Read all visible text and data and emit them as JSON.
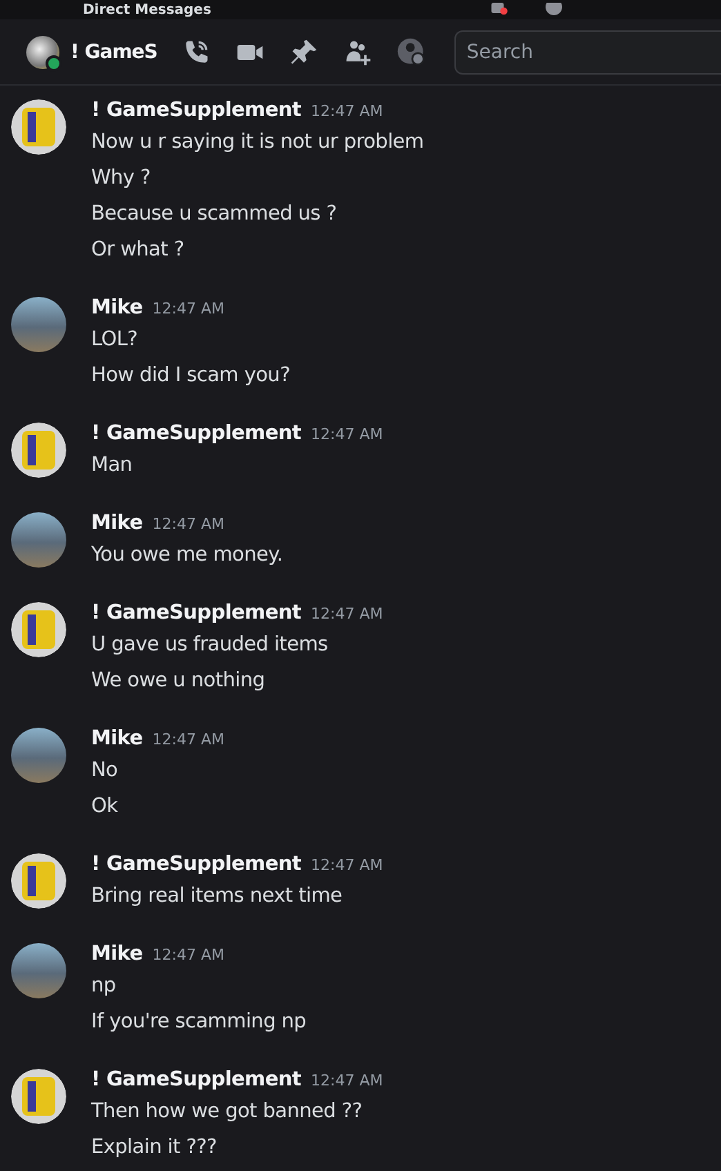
{
  "top_bar": {
    "title": "Direct Messages"
  },
  "header": {
    "name": "! GameS",
    "online": true,
    "search": {
      "placeholder": "Search"
    }
  },
  "messages": [
    {
      "author": "! GameSupplement",
      "kind": "logo",
      "time": "12:47 AM",
      "lines": [
        "Now u r saying it is not ur problem",
        "Why ?",
        "Because u scammed us ?",
        "Or what ?"
      ]
    },
    {
      "author": "Mike",
      "kind": "photo",
      "time": "12:47 AM",
      "lines": [
        "LOL?",
        "How did I scam you?"
      ]
    },
    {
      "author": "! GameSupplement",
      "kind": "logo",
      "time": "12:47 AM",
      "lines": [
        "Man"
      ]
    },
    {
      "author": "Mike",
      "kind": "photo",
      "time": "12:47 AM",
      "lines": [
        "You owe me money."
      ]
    },
    {
      "author": "! GameSupplement",
      "kind": "logo",
      "time": "12:47 AM",
      "lines": [
        "U gave us frauded items",
        "We owe u nothing"
      ]
    },
    {
      "author": "Mike",
      "kind": "photo",
      "time": "12:47 AM",
      "lines": [
        "No",
        "Ok"
      ]
    },
    {
      "author": "! GameSupplement",
      "kind": "logo",
      "time": "12:47 AM",
      "lines": [
        "Bring real items next time"
      ]
    },
    {
      "author": "Mike",
      "kind": "photo",
      "time": "12:47 AM",
      "lines": [
        "np",
        "If you're scamming np"
      ]
    },
    {
      "author": "! GameSupplement",
      "kind": "logo",
      "time": "12:47 AM",
      "lines": [
        "Then how we got banned ??",
        "Explain it ???"
      ]
    }
  ]
}
